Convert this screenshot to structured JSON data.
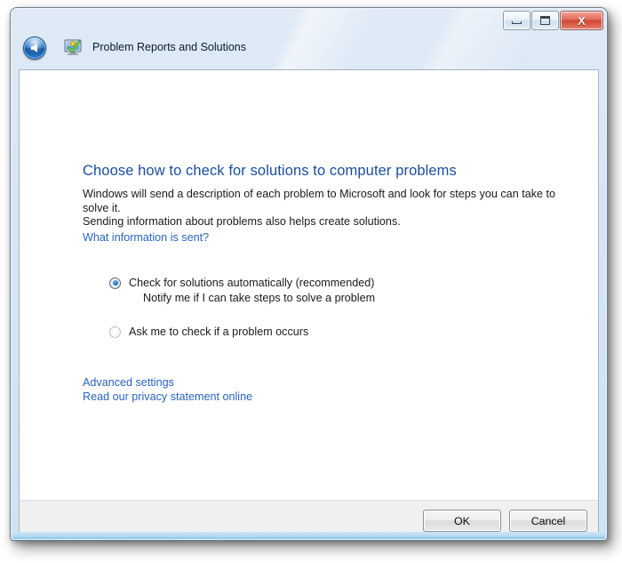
{
  "window": {
    "title": "Problem Reports and Solutions",
    "app_icon_name": "problem-reports-icon",
    "back_button_label": "Back",
    "caption": {
      "minimize_label": "Minimize",
      "maximize_label": "Maximize",
      "close_label": "Close",
      "close_glyph": "X",
      "close_color": "#cf4631"
    }
  },
  "content": {
    "heading": "Choose how to check for solutions to computer problems",
    "heading_color": "#1b4d9c",
    "paragraph_line1": "Windows will send a description of each problem to Microsoft and look for steps you can take to solve it.",
    "paragraph_line2": "Sending information about problems also helps create solutions.",
    "info_link": "What information is sent?",
    "link_color": "#2a63c0",
    "options": [
      {
        "label": "Check for solutions automatically (recommended)",
        "sub_label": "Notify me if I can take steps to solve a problem",
        "selected": true
      },
      {
        "label": "Ask me to check if a problem occurs",
        "sub_label": "",
        "selected": false
      }
    ],
    "links": [
      {
        "label": "Advanced settings"
      },
      {
        "label": "Read our privacy statement online"
      }
    ]
  },
  "footer": {
    "ok_label": "OK",
    "cancel_label": "Cancel"
  }
}
